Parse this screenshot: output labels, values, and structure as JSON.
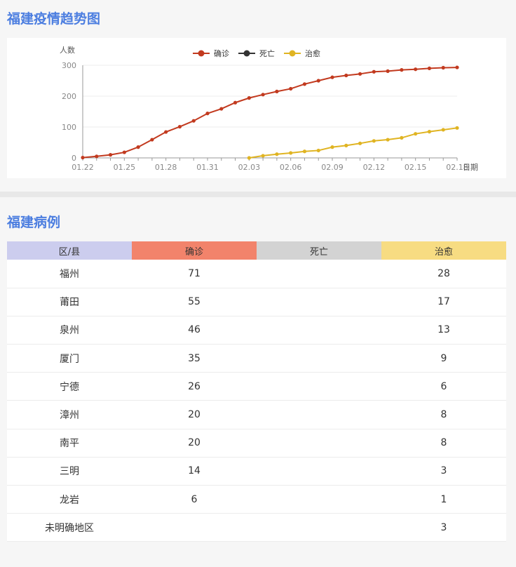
{
  "titles": {
    "trend": "福建疫情趋势图",
    "cases": "福建病例"
  },
  "chart_data": {
    "type": "line",
    "ylabel": "人数",
    "xlabel": "日期",
    "ylim": [
      0,
      300
    ],
    "yticks": [
      0,
      100,
      200,
      300
    ],
    "x": [
      "01.22",
      "01.23",
      "01.24",
      "01.25",
      "01.26",
      "01.27",
      "01.28",
      "01.29",
      "01.30",
      "01.31",
      "02.01",
      "02.02",
      "02.03",
      "02.04",
      "02.05",
      "02.06",
      "02.07",
      "02.08",
      "02.09",
      "02.10",
      "02.11",
      "02.12",
      "02.13",
      "02.14",
      "02.15",
      "02.16",
      "02.17",
      "02.18"
    ],
    "xticks": [
      "01.22",
      "01.25",
      "01.28",
      "01.31",
      "02.03",
      "02.06",
      "02.09",
      "02.12",
      "02.15",
      "02.18"
    ],
    "legend_position": "top-center",
    "series": [
      {
        "name": "确诊",
        "color": "#c23a1f",
        "values": [
          1,
          5,
          10,
          18,
          35,
          59,
          84,
          101,
          120,
          144,
          159,
          179,
          194,
          205,
          215,
          224,
          239,
          250,
          261,
          267,
          272,
          279,
          281,
          285,
          287,
          290,
          292,
          293
        ]
      },
      {
        "name": "死亡",
        "color": "#333333",
        "values": []
      },
      {
        "name": "治愈",
        "color": "#e0b422",
        "values": [
          null,
          null,
          null,
          null,
          null,
          null,
          null,
          null,
          null,
          null,
          null,
          null,
          0,
          7,
          12,
          16,
          21,
          24,
          35,
          40,
          47,
          55,
          59,
          65,
          78,
          85,
          91,
          97
        ]
      }
    ]
  },
  "table": {
    "headers": [
      "区/县",
      "确诊",
      "死亡",
      "治愈"
    ],
    "rows": [
      [
        "福州",
        "71",
        "",
        "28"
      ],
      [
        "莆田",
        "55",
        "",
        "17"
      ],
      [
        "泉州",
        "46",
        "",
        "13"
      ],
      [
        "厦门",
        "35",
        "",
        "9"
      ],
      [
        "宁德",
        "26",
        "",
        "6"
      ],
      [
        "漳州",
        "20",
        "",
        "8"
      ],
      [
        "南平",
        "20",
        "",
        "8"
      ],
      [
        "三明",
        "14",
        "",
        "3"
      ],
      [
        "龙岩",
        "6",
        "",
        "1"
      ],
      [
        "未明确地区",
        "",
        "",
        "3"
      ]
    ]
  }
}
